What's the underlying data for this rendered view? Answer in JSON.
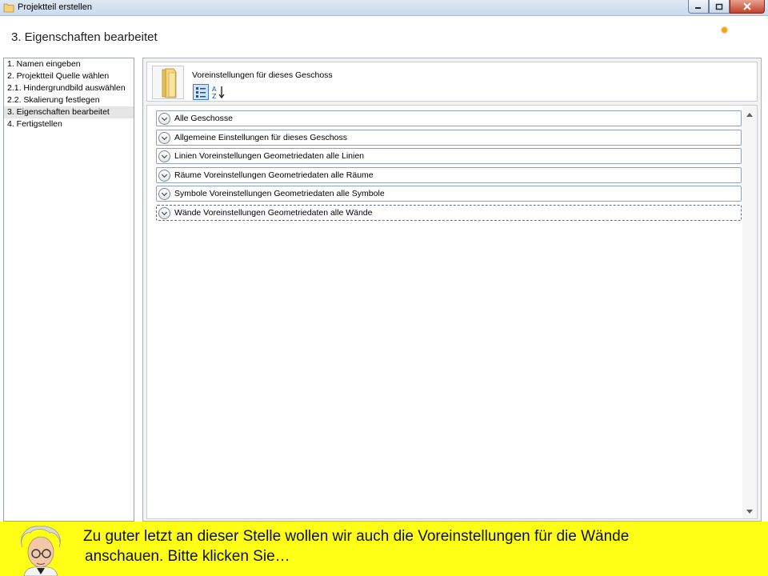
{
  "window": {
    "title": "Projektteil erstellen"
  },
  "header": {
    "page_title": "3. Eigenschaften bearbeitet"
  },
  "steps": [
    {
      "label": "1. Namen eingeben",
      "active": false
    },
    {
      "label": "2. Projektteil Quelle wählen",
      "active": false
    },
    {
      "label": "2.1. Hindergrundbild auswählen",
      "active": false
    },
    {
      "label": "2.2. Skalierung festlegen",
      "active": false
    },
    {
      "label": "3. Eigenschaften bearbeitet",
      "active": true
    },
    {
      "label": "4. Fertigstellen",
      "active": false
    }
  ],
  "settings": {
    "title": "Voreinstellungen für dieses Geschoss",
    "sections": [
      {
        "label": "Alle Geschosse"
      },
      {
        "label": "Allgemeine Einstellungen für dieses Geschoss"
      },
      {
        "label": "Linien Voreinstellungen Geometriedaten alle Linien"
      },
      {
        "label": "Räume Voreinstellungen Geometriedaten alle Räume"
      },
      {
        "label": "Symbole Voreinstellungen Geometriedaten alle Symbole"
      },
      {
        "label": "Wände Voreinstellungen Geometriedaten alle Wände"
      }
    ]
  },
  "hint": {
    "line1": "Zu guter letzt an dieser Stelle wollen wir auch die Voreinstellungen für die Wände",
    "line2": "anschauen. Bitte klicken Sie…"
  },
  "colors": {
    "hint_background": "#ffff16",
    "status_dot": "#f2a61d",
    "titlebar": "#c9d9ee",
    "close_button": "#c2422a"
  },
  "icons": {
    "title": "folder-icon",
    "minimize": "minimize-icon",
    "maximize": "maximize-icon",
    "close": "close-icon",
    "large_folder": "folder-icon",
    "categorized": "categorized-view-icon",
    "sort": "sort-alphabetical-icon",
    "expander": "chevron-down-icon"
  }
}
